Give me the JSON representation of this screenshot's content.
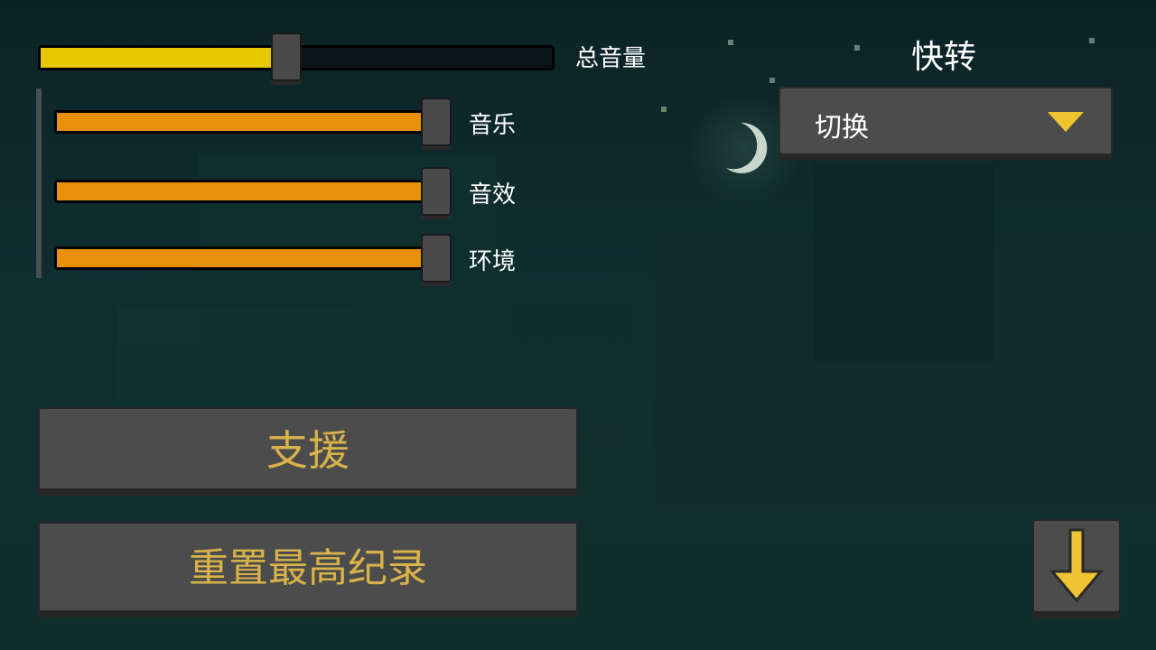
{
  "master_volume": {
    "label": "总音量",
    "value": 0.48,
    "fill_color": "#e6c800"
  },
  "sub_volumes": [
    {
      "label": "音乐",
      "value": 1.0
    },
    {
      "label": "音效",
      "value": 1.0
    },
    {
      "label": "环境",
      "value": 1.0
    }
  ],
  "sub_fill_color": "#e8900a",
  "quick_switch": {
    "title": "快转",
    "dropdown_value": "切换"
  },
  "buttons": {
    "support": "支援",
    "reset_highscore": "重置最高纪录"
  },
  "colors": {
    "button_text": "#d9b24a",
    "arrow": "#f0c430"
  }
}
